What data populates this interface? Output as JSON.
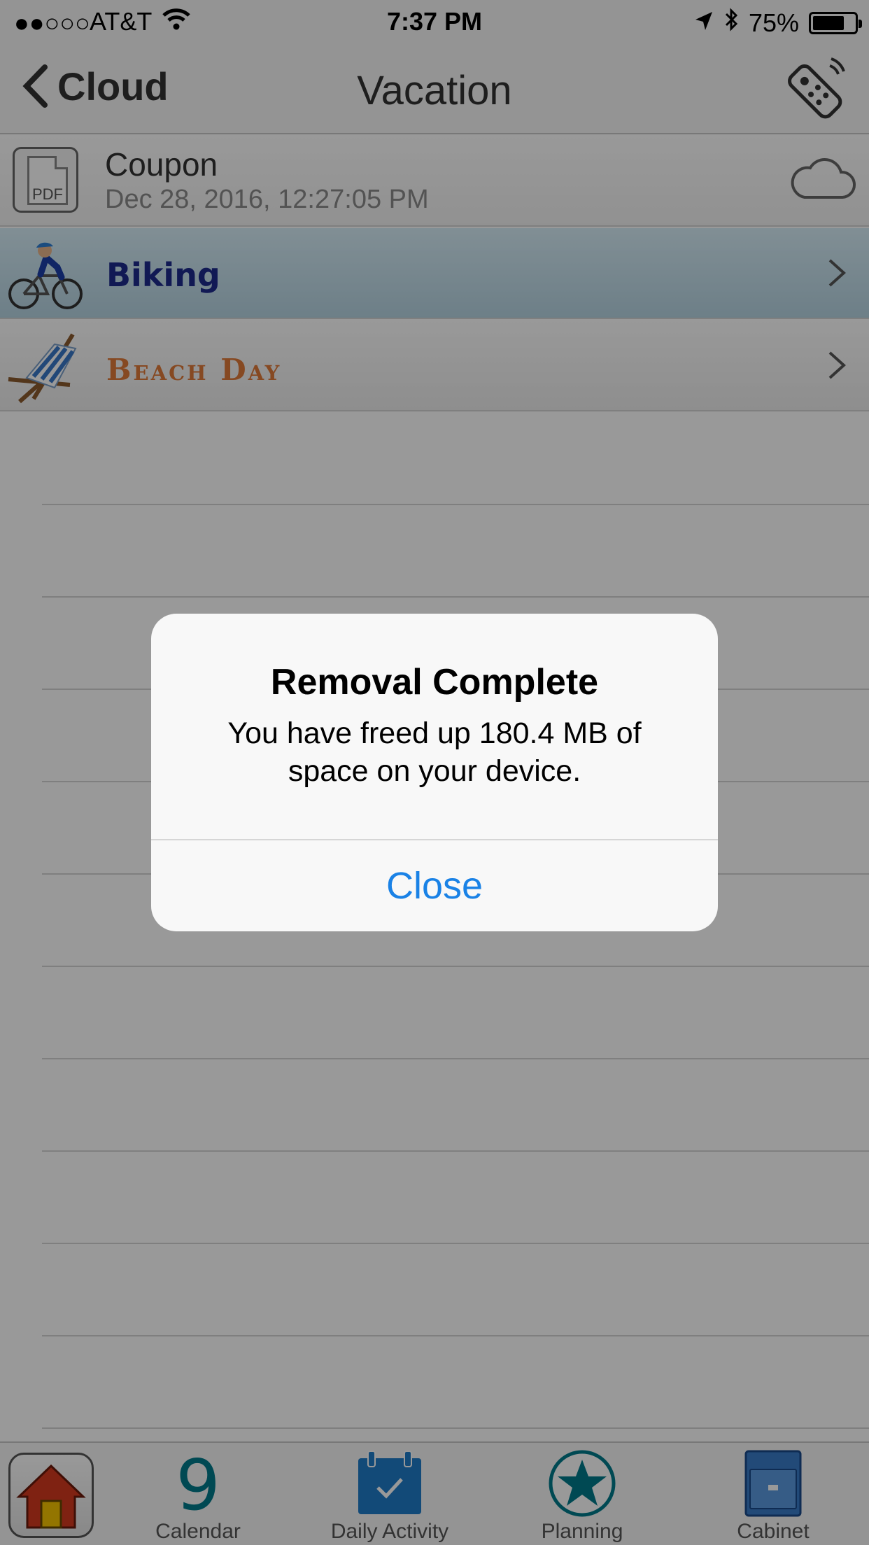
{
  "status_bar": {
    "signal": "●●○○○",
    "carrier": "AT&T",
    "time": "7:37 PM",
    "battery": "75%",
    "battery_level": 0.75
  },
  "nav": {
    "back_label": "Cloud",
    "title": "Vacation"
  },
  "list": {
    "coupon": {
      "icon_label": "PDF",
      "name": "Coupon",
      "date": "Dec 28, 2016, 12:27:05 PM"
    },
    "biking": {
      "label": "Biking"
    },
    "beach": {
      "label": "Beach Day"
    }
  },
  "tabbar": {
    "calendar": {
      "number": "9",
      "label": "Calendar"
    },
    "daily": {
      "label": "Daily Activity"
    },
    "planning": {
      "label": "Planning"
    },
    "cabinet": {
      "label": "Cabinet"
    }
  },
  "alert": {
    "title": "Removal Complete",
    "message": "You have freed up 180.4 MB of space on your device.",
    "close_label": "Close"
  },
  "colors": {
    "accent": "#1a82e6",
    "biking_text": "#1d2a8c",
    "beach_text": "#e07a3a",
    "teal": "#007a8a"
  }
}
